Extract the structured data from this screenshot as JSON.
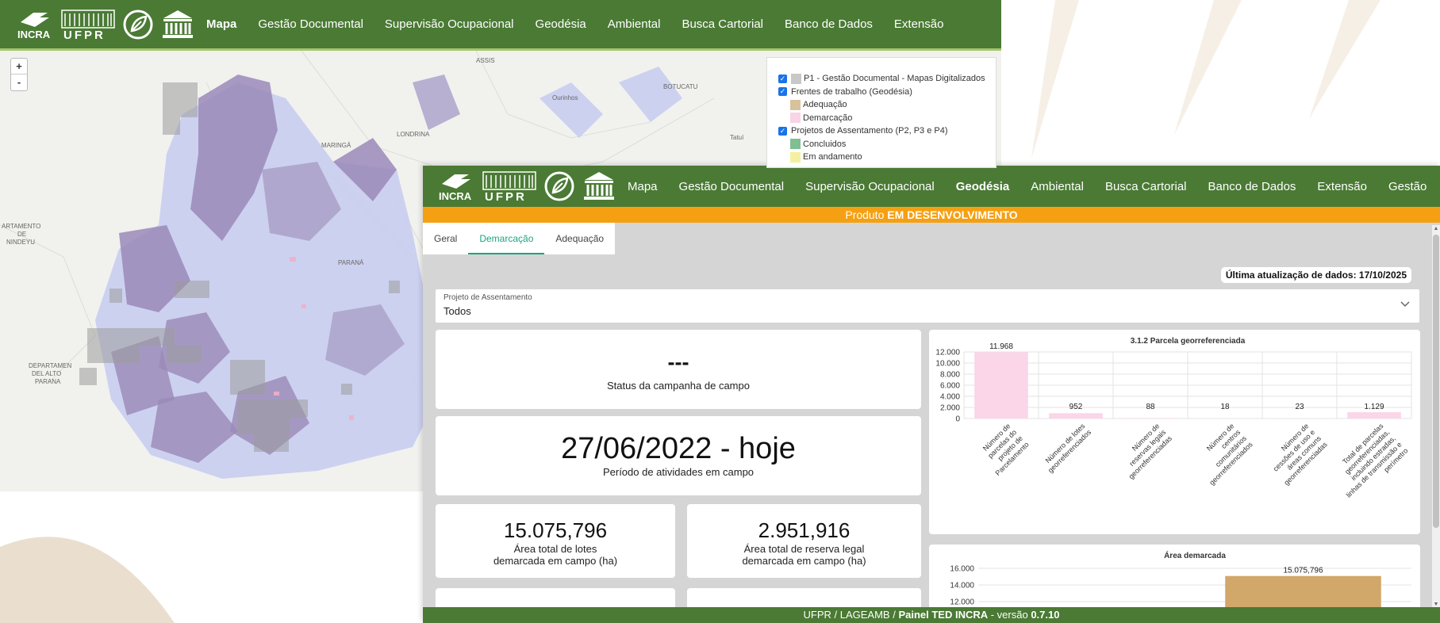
{
  "brand": {
    "incra": "INCRA",
    "ufpr": "UFPR"
  },
  "back": {
    "nav": [
      "Mapa",
      "Gestão Documental",
      "Supervisão Ocupacional",
      "Geodésia",
      "Ambiental",
      "Busca Cartorial",
      "Banco de Dados",
      "Extensão"
    ],
    "zoom_in": "+",
    "zoom_out": "-",
    "map_labels": [
      "ASSIS",
      "BOTUCATU",
      "Ourinhos",
      "MARINGÁ",
      "LONDRINA",
      "PARANÁ",
      "Tatuí",
      "ARTAMENTO",
      "DE",
      "NINDEYU",
      "DEPARTAMEN",
      "DEL ALTO",
      "PARANA"
    ],
    "legend": {
      "items": [
        {
          "label": "P1 - Gestão Documental - Mapas Digitalizados",
          "checked": true,
          "swatch": "#c8c8c8"
        },
        {
          "label": "Frentes de trabalho (Geodésia)",
          "checked": true
        },
        {
          "label": "Adequação",
          "sub": true,
          "swatch": "#d8c29c"
        },
        {
          "label": "Demarcação",
          "sub": true,
          "swatch": "#f9d3e6"
        },
        {
          "label": "Projetos de Assentamento (P2, P3 e P4)",
          "checked": true
        },
        {
          "label": "Concluidos",
          "sub": true,
          "swatch": "#7fbf92"
        },
        {
          "label": "Em andamento",
          "sub": true,
          "swatch": "#f4f0a0"
        }
      ]
    }
  },
  "front": {
    "nav": [
      "Mapa",
      "Gestão Documental",
      "Supervisão Ocupacional",
      "Geodésia",
      "Ambiental",
      "Busca Cartorial",
      "Banco de Dados",
      "Extensão",
      "Gestão"
    ],
    "active_nav": "Geodésia",
    "banner_prefix": "Produto",
    "banner_status": "EM DESENVOLVIMENTO",
    "tabs": [
      "Geral",
      "Demarcação",
      "Adequação"
    ],
    "active_tab": "Demarcação",
    "last_update": "Última atualização de dados: 17/10/2025",
    "select": {
      "label": "Projeto de Assentamento",
      "value": "Todos"
    },
    "cards": {
      "campaign_status_value": "---",
      "campaign_status_label": "Status da campanha de campo",
      "period_value": "27/06/2022 - hoje",
      "period_label": "Período de atividades em campo",
      "area_lots_value": "15.075,796",
      "area_lots_label1": "Área total de lotes",
      "area_lots_label2": "demarcada em campo (ha)",
      "area_reserve_value": "2.951,916",
      "area_reserve_label1": "Área total de reserva legal",
      "area_reserve_label2": "demarcada em campo (ha)"
    },
    "footer": {
      "prefix": "UFPR / LAGEAMB / ",
      "panel": "Painel TED INCRA",
      "mid": " - versão ",
      "version": "0.7.10"
    }
  },
  "chart_data": [
    {
      "type": "bar",
      "title": "3.1.2 Parcela georreferenciada",
      "categories": [
        [
          "Número de",
          "parcelas do",
          "projeto de",
          "Parcelamento"
        ],
        [
          "Número de lotes",
          "georreferenciados"
        ],
        [
          "Número de",
          "reservas legais",
          "georreferenciadas"
        ],
        [
          "Número de",
          "centros",
          "comunitários",
          "georreferenciados"
        ],
        [
          "Número de",
          "cessões de uso e",
          "áreas comuns",
          "georreferenciadas"
        ],
        [
          "Total de parcelas",
          "georreferenciadas,",
          "incluindo estradas,",
          "linhas de transmissão e",
          "perímetro"
        ]
      ],
      "values": [
        11968,
        952,
        88,
        18,
        23,
        1129
      ],
      "value_labels": [
        "11.968",
        "952",
        "88",
        "18",
        "23",
        "1.129"
      ],
      "ylim": [
        0,
        12000
      ],
      "yticks": [
        "0",
        "2.000",
        "4.000",
        "6.000",
        "8.000",
        "10.000",
        "12.000"
      ],
      "color": "#fbd5e8",
      "grid": true
    },
    {
      "type": "bar",
      "title": "Área demarcada",
      "values": [
        15075.796
      ],
      "value_labels": [
        "15.075,796"
      ],
      "ylim": [
        0,
        16000
      ],
      "yticks_visible": [
        "12.000",
        "14.000",
        "16.000"
      ],
      "color": "#d1a86a",
      "grid": true
    }
  ]
}
